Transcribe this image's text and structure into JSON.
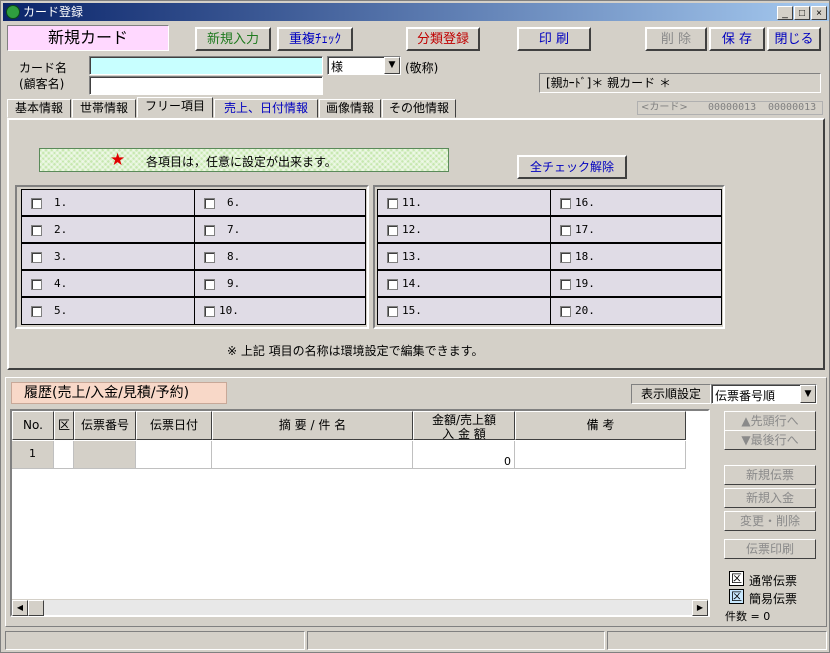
{
  "window": {
    "title": "カード登録"
  },
  "header": {
    "mode_label": "新規カード",
    "btn_new_input": "新規入力",
    "btn_dup_check": "重複ﾁｪｯｸ",
    "btn_category": "分類登録",
    "btn_print": "印 刷",
    "btn_delete": "削 除",
    "btn_save": "保 存",
    "btn_close": "閉じる"
  },
  "card": {
    "name_label": "カード名",
    "customer_label": "(顧客名)",
    "honorific_value": "様",
    "honorific_note": "(敬称)",
    "parent_card_info": "[親ｶｰﾄﾞ]＊  親カード  ＊"
  },
  "tabs": [
    "基本情報",
    "世帯情報",
    "フリー項目",
    "売上、日付情報",
    "画像情報",
    "その他情報"
  ],
  "card_nav": {
    "label": "<カード>",
    "from": "00000013",
    "to": "00000013"
  },
  "free_items": {
    "notice": "各項目は，任意に設定が出来ます。",
    "uncheck_all": "全チェック解除",
    "items": [
      "1.",
      "2.",
      "3.",
      "4.",
      "5.",
      "6.",
      "7.",
      "8.",
      "9.",
      "10.",
      "11.",
      "12.",
      "13.",
      "14.",
      "15.",
      "16.",
      "17.",
      "18.",
      "19.",
      "20."
    ],
    "footer_note": "※ 上記 項目の名称は環境設定で編集できます。"
  },
  "history": {
    "title": "履歴(売上/入金/見積/予約)",
    "sort_label": "表示順設定",
    "sort_value": "伝票番号順",
    "columns": [
      "No.",
      "区",
      "伝票番号",
      "伝票日付",
      "摘 要 / 件 名",
      "金額/売上額",
      "入 金 額",
      "備 考"
    ],
    "rows": [
      {
        "no": "1",
        "amount": "0"
      }
    ],
    "side_buttons": [
      "▲先頭行へ",
      "▼最後行へ",
      "新規伝票",
      "新規入金",
      "変更・削除",
      "伝票印刷"
    ],
    "legend_normal": "通常伝票",
    "legend_simple": "簡易伝票",
    "legend_mark": "区",
    "count_text": "件数 = 0"
  },
  "colors": {
    "title_start": "#0a246a",
    "mode_bg": "#ffd8ff",
    "green_text": "#1f7a1f",
    "blue_text": "#0000c0",
    "red_text": "#c00000",
    "tab_blue": "#0000c0"
  }
}
